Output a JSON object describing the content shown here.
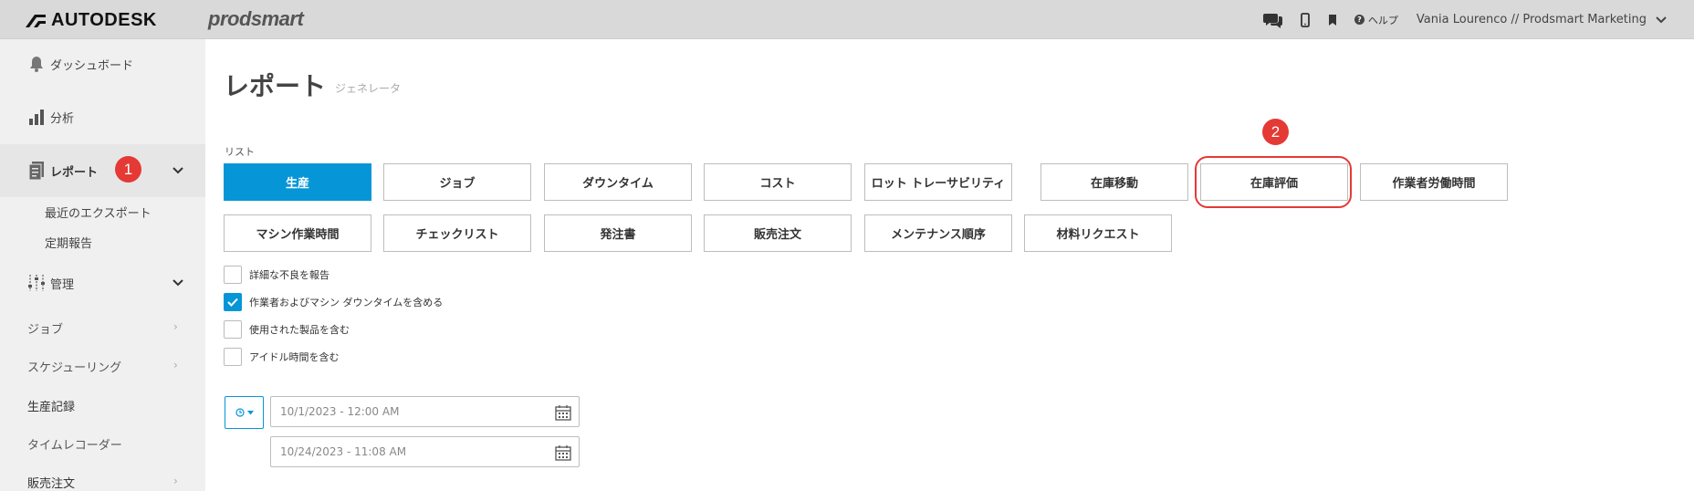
{
  "header": {
    "brand": "AUTODESK",
    "product": "prodsmart",
    "icons": [
      "chat-icon",
      "mobile-icon",
      "bookmark-icon"
    ],
    "help_label": "ヘルプ",
    "user_label": "Vania Lourenco // Prodsmart Marketing"
  },
  "sidebar": {
    "dashboard": "ダッシュボード",
    "analytics": "分析",
    "reports": "レポート",
    "recent_exports": "最近のエクスポート",
    "scheduled_reports": "定期報告",
    "management": "管理",
    "jobs": "ジョブ",
    "scheduling": "スケジューリング",
    "production_records": "生産記録",
    "time_recorder": "タイムレコーダー",
    "sales_orders": "販売注文"
  },
  "annotations": {
    "step1": "1",
    "step2": "2",
    "color": "#e53935"
  },
  "main": {
    "title": "レポート",
    "subtitle": "ジェネレータ",
    "list_label": "リスト",
    "report_buttons_row1": [
      "生産",
      "ジョブ",
      "ダウンタイム",
      "コスト",
      "ロット トレーサビリティ",
      "在庫移動",
      "在庫評価",
      "作業者労働時間"
    ],
    "report_buttons_row2": [
      "マシン作業時間",
      "チェックリスト",
      "発注書",
      "販売注文",
      "メンテナンス順序",
      "材料リクエスト"
    ],
    "selected_report": "生産",
    "highlighted_report": "在庫評価",
    "options": [
      {
        "label": "詳細な不良を報告",
        "checked": false
      },
      {
        "label": "作業者およびマシン ダウンタイムを含める",
        "checked": true
      },
      {
        "label": "使用された製品を含む",
        "checked": false
      },
      {
        "label": "アイドル時間を含む",
        "checked": false
      }
    ],
    "date_from": "10/1/2023 - 12:00 AM",
    "date_to": "10/24/2023 - 11:08 AM"
  },
  "colors": {
    "accent": "#0696d7",
    "sidebar_bg": "#f0f0f0",
    "topbar_bg": "#d9d9d9"
  }
}
